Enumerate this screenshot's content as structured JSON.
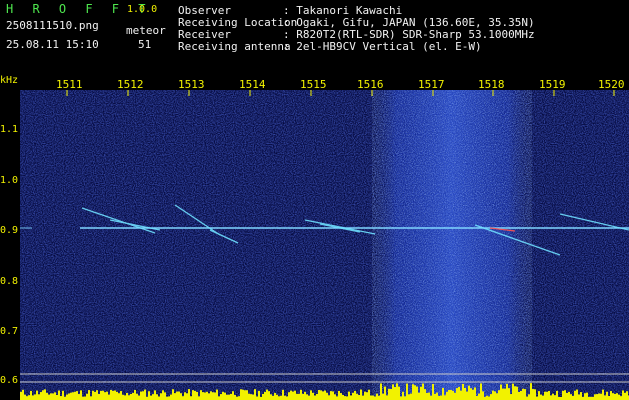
{
  "header": {
    "app_title": "H R O F F T",
    "version": "1.0.0",
    "filename": "2508111510.png",
    "meteor_label": "meteor",
    "timestamp": "25.08.11 15:10",
    "meteor_count": "51"
  },
  "info": [
    {
      "key": "Observer",
      "value": ": Takanori Kawachi"
    },
    {
      "key": "Receiving Location",
      "value": ": Ogaki, Gifu, JAPAN (136.60E, 35.35N)"
    },
    {
      "key": "Receiver",
      "value": ": R820T2(RTL-SDR) SDR-Sharp 53.1000MHz"
    },
    {
      "key": "Receiving antenna",
      "value": ": 2el-HB9CV Vertical (el. E-W)"
    }
  ],
  "axis": {
    "unit": "kHz",
    "y_ticks": [
      "1.1",
      "1.0",
      "0.9",
      "0.8",
      "0.7",
      "0.6"
    ],
    "x_ticks": [
      "1511",
      "1512",
      "1513",
      "1514",
      "1515",
      "1516",
      "1517",
      "1518",
      "1519",
      "1520"
    ]
  },
  "colors": {
    "background": "#000000",
    "title_green": "#4ee64e",
    "label_yellow": "#f2f200",
    "noise_blue": "#1a2fb0",
    "carrier_cyan": "#7fd6ff"
  }
}
